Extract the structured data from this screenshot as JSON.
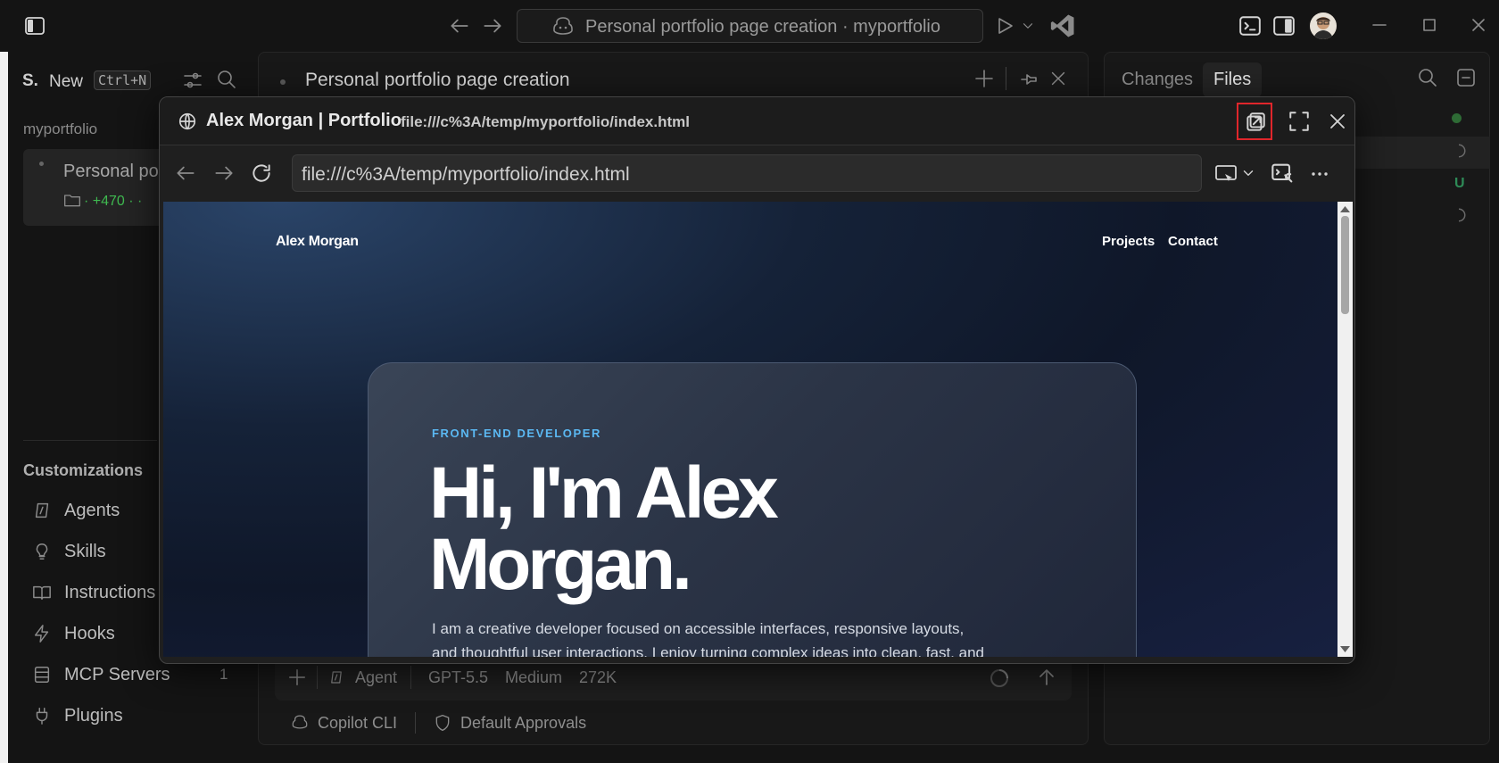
{
  "window": {
    "command_center": "Personal portfolio page creation · myportfolio"
  },
  "sessions": {
    "header_letter": "S.",
    "new_label": "New",
    "new_shortcut": "Ctrl+N",
    "workspace": "myportfolio",
    "session_title": "Personal po",
    "session_meta": "· +470 · ·",
    "customizations_label": "Customizations",
    "items": [
      {
        "label": "Agents",
        "icon": "agents-icon"
      },
      {
        "label": "Skills",
        "icon": "bulb-icon"
      },
      {
        "label": "Instructions",
        "icon": "book-icon"
      },
      {
        "label": "Hooks",
        "icon": "lightning-icon"
      },
      {
        "label": "MCP Servers",
        "icon": "server-icon",
        "count": "1"
      },
      {
        "label": "Plugins",
        "icon": "plug-icon"
      }
    ]
  },
  "chat": {
    "title": "Personal portfolio page creation",
    "mode": "Agent",
    "model": "GPT-5.5",
    "effort": "Medium",
    "context": "272K",
    "footer_cli": "Copilot CLI",
    "footer_approvals": "Default Approvals"
  },
  "right_panel": {
    "tabs": [
      "Changes",
      "Files"
    ],
    "active_tab": "Files",
    "status_u": "U"
  },
  "browser": {
    "page_title": "Alex Morgan | Portfolio",
    "url_header": "file:///c%3A/temp/myportfolio/index.html",
    "url": "file:///c%3A/temp/myportfolio/index.html"
  },
  "site": {
    "brand": "Alex Morgan",
    "nav": [
      "Projects",
      "Contact"
    ],
    "eyebrow": "FRONT-END DEVELOPER",
    "hero_line1": "Hi, I'm Alex",
    "hero_line2": "Morgan.",
    "intro_line1": "I am a creative developer focused on accessible interfaces, responsive layouts,",
    "intro_line2": "and thoughtful user interactions. I enjoy turning complex ideas into clean, fast, and"
  },
  "colors": {
    "accent_blue": "#5bb8f2",
    "highlight_red": "#e0262b",
    "status_green": "#3fb950"
  }
}
